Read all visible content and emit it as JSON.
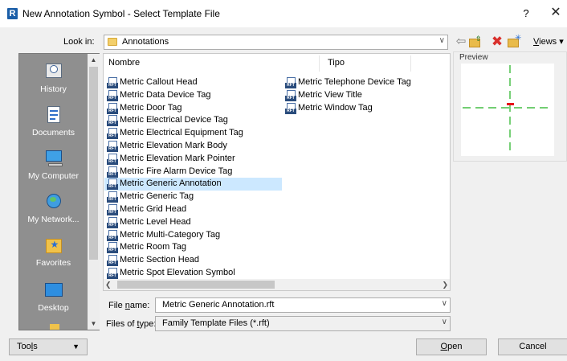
{
  "window": {
    "title": "New Annotation Symbol - Select Template File",
    "app_icon_letter": "R",
    "help_glyph": "?",
    "close_glyph": "✕"
  },
  "look_in": {
    "label": "Look in:",
    "value": "Annotations"
  },
  "toolbar": {
    "views_first": "V",
    "views_rest": "iews",
    "views_caret": "▾"
  },
  "places": [
    {
      "label": "History",
      "icon": "history-icon"
    },
    {
      "label": "Documents",
      "icon": "documents-icon"
    },
    {
      "label": "My Computer",
      "icon": "computer-icon"
    },
    {
      "label": "My Network...",
      "icon": "network-icon"
    },
    {
      "label": "Favorites",
      "icon": "favorites-icon"
    },
    {
      "label": "Desktop",
      "icon": "desktop-icon"
    }
  ],
  "columns": {
    "name": "Nombre",
    "type": "Tipo"
  },
  "files": [
    {
      "name": "Metric Callout Head"
    },
    {
      "name": "Metric Data Device Tag"
    },
    {
      "name": "Metric Door Tag"
    },
    {
      "name": "Metric Electrical Device Tag"
    },
    {
      "name": "Metric Electrical Equipment Tag"
    },
    {
      "name": "Metric Elevation Mark Body"
    },
    {
      "name": "Metric Elevation Mark Pointer"
    },
    {
      "name": "Metric Fire Alarm Device Tag"
    },
    {
      "name": "Metric Generic Annotation",
      "selected": true
    },
    {
      "name": "Metric Generic Tag"
    },
    {
      "name": "Metric Grid Head"
    },
    {
      "name": "Metric Level Head"
    },
    {
      "name": "Metric Multi-Category Tag"
    },
    {
      "name": "Metric Room Tag"
    },
    {
      "name": "Metric Section Head"
    },
    {
      "name": "Metric Spot Elevation Symbol"
    },
    {
      "name": "Metric Telephone Device Tag"
    },
    {
      "name": "Metric View Title"
    },
    {
      "name": "Metric Window Tag"
    }
  ],
  "file_icon_badge": "RFT",
  "preview": {
    "label": "Preview",
    "colors": {
      "guide": "#1fb01f",
      "origin": "#e8101a"
    }
  },
  "file_name": {
    "label_first": "File ",
    "label_accel": "n",
    "label_rest": "ame:",
    "value": "Metric Generic Annotation.rft"
  },
  "file_type": {
    "label_first": "Files of ",
    "label_accel": "t",
    "label_rest": "ype:",
    "value": "Family Template Files  (*.rft)"
  },
  "buttons": {
    "tools_first": "Too",
    "tools_accel": "l",
    "tools_rest": "s",
    "open_accel": "O",
    "open_rest": "pen",
    "cancel": "Cancel"
  }
}
